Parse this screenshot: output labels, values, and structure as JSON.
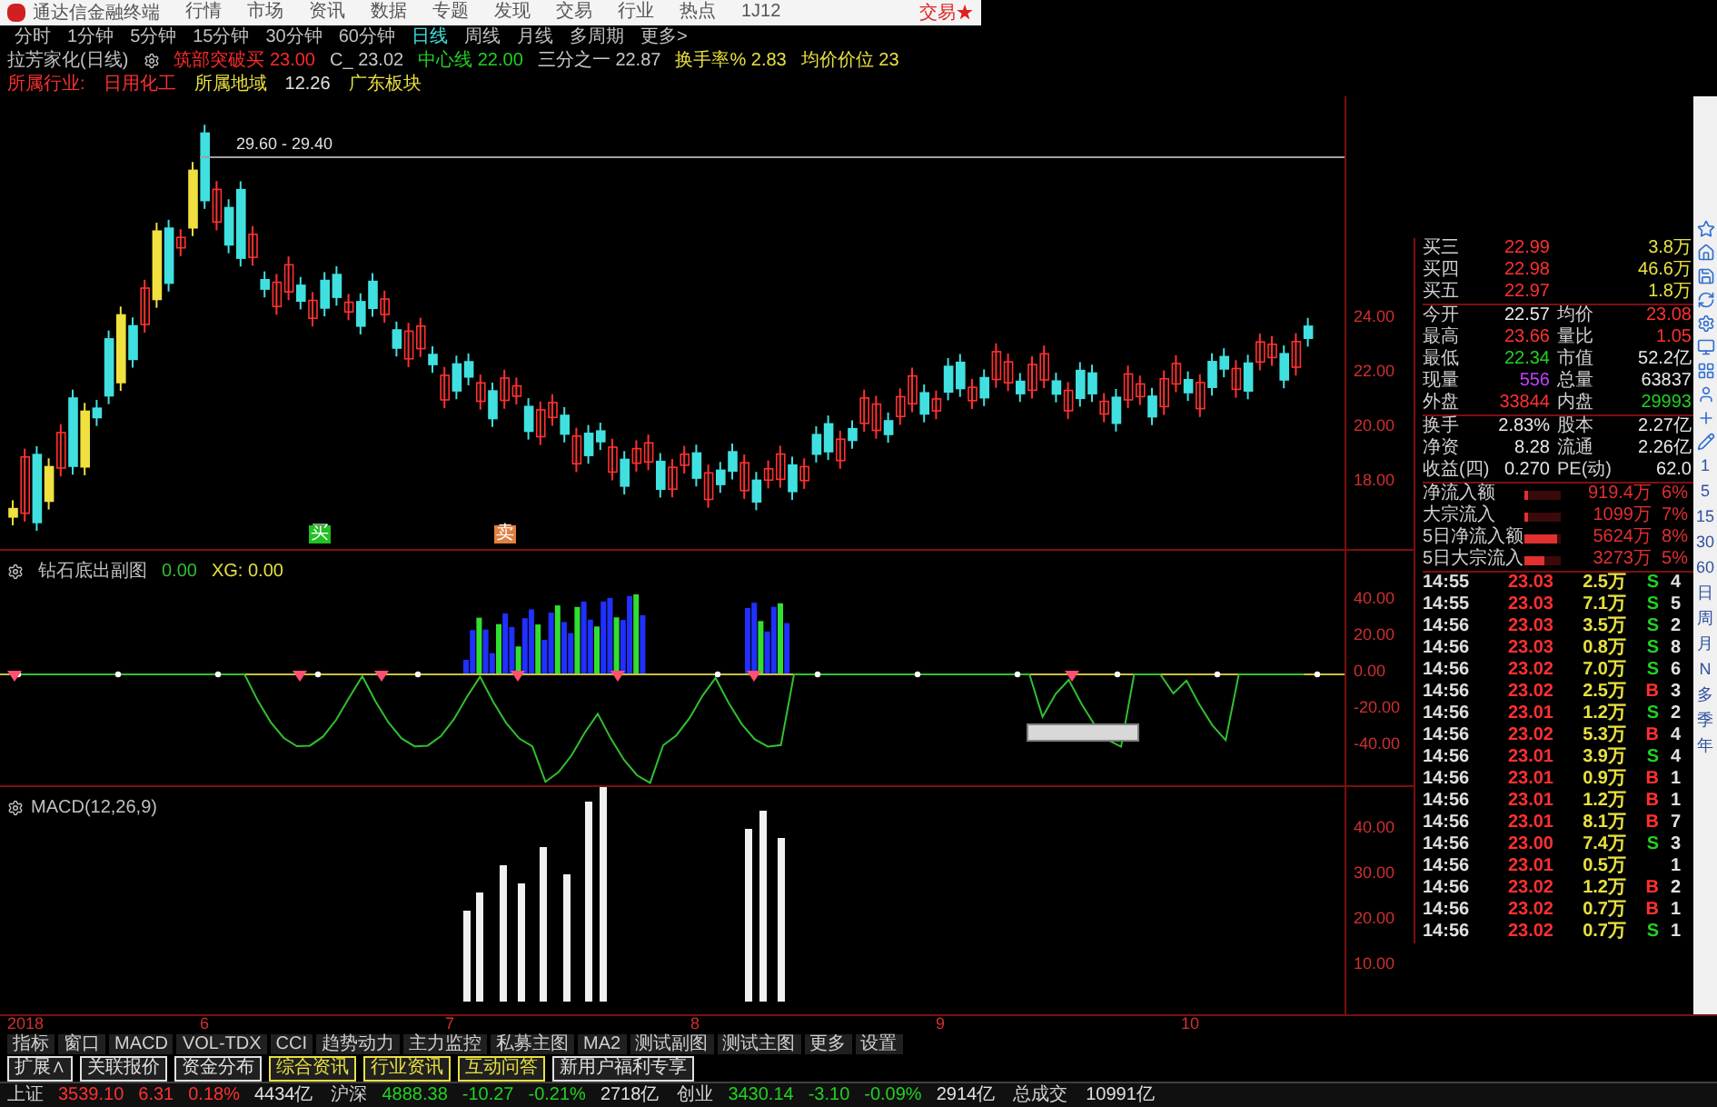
{
  "window": {
    "title": "通达信金融终端",
    "menu": [
      "行情",
      "市场",
      "资讯",
      "数据",
      "专题",
      "发现",
      "交易",
      "行业",
      "热点",
      "1J12"
    ],
    "trade_link": "交易★"
  },
  "periods": [
    {
      "label": "分时",
      "selected": false
    },
    {
      "label": "1分钟",
      "selected": false
    },
    {
      "label": "5分钟",
      "selected": false
    },
    {
      "label": "15分钟",
      "selected": false
    },
    {
      "label": "30分钟",
      "selected": false
    },
    {
      "label": "60分钟",
      "selected": false
    },
    {
      "label": "日线",
      "selected": true
    },
    {
      "label": "周线",
      "selected": false
    },
    {
      "label": "月线",
      "selected": false
    },
    {
      "label": "多周期",
      "selected": false
    },
    {
      "label": "更多>",
      "selected": false
    }
  ],
  "info": {
    "stock": "拉芳家化(日线)",
    "items": [
      {
        "label": "筑部突破买",
        "value": "23.00",
        "color": "#ff2a2a"
      },
      {
        "label": "C_",
        "value": "23.02",
        "color": "#c8c8c8"
      },
      {
        "label": "中心线",
        "value": "22.00",
        "color": "#22d022"
      },
      {
        "label": "三分之一",
        "value": "22.87",
        "color": "#c8c8c8"
      },
      {
        "label": "换手率%",
        "value": "2.83",
        "color": "#e8e040"
      },
      {
        "label": "均价价位",
        "value": "23",
        "color": "#e8e040"
      }
    ]
  },
  "tags": [
    {
      "text": "所属行业:",
      "color": "#ff3030"
    },
    {
      "text": "日用化工",
      "color": "#ff3030"
    },
    {
      "text": "所属地域",
      "color": "#e8e040"
    },
    {
      "text": "12.26",
      "color": "#e0e0e0"
    },
    {
      "text": "广东板块",
      "color": "#e8e040"
    }
  ],
  "main_chart": {
    "range_label": "29.60 - 29.40",
    "axis": [
      "24.00",
      "22.00",
      "20.00",
      "18.00"
    ],
    "signals": [
      {
        "text": "买",
        "color": "#22c022"
      },
      {
        "text": "卖",
        "color": "#e08040"
      }
    ]
  },
  "sub_chart": {
    "title": "钻石底出副图",
    "value": "0.00",
    "xg_label": "XG: 0.00",
    "axis": [
      "40.00",
      "20.00",
      "0.00",
      "-20.00",
      "-40.00"
    ]
  },
  "macd_chart": {
    "title": "MACD(12,26,9)",
    "axis": [
      "40.00",
      "30.00",
      "20.00",
      "10.00"
    ]
  },
  "dates": [
    "2018",
    "6",
    "7",
    "8",
    "9",
    "10"
  ],
  "quotes": [
    {
      "left": {
        "label": "买三",
        "value": "22.99",
        "color": "#ff3030"
      },
      "right": {
        "value": "3.8万",
        "color": "#e8e040"
      }
    },
    {
      "left": {
        "label": "买四",
        "value": "22.98",
        "color": "#ff3030"
      },
      "right": {
        "value": "46.6万",
        "color": "#e8e040"
      }
    },
    {
      "left": {
        "label": "买五",
        "value": "22.97",
        "color": "#ff3030"
      },
      "right": {
        "value": "1.8万",
        "color": "#e8e040"
      }
    },
    {
      "left": {
        "label": "今开",
        "value": "22.57",
        "color": "#e8e8e8"
      },
      "right": {
        "label": "均价",
        "value": "23.08",
        "color": "#ff3030"
      }
    },
    {
      "left": {
        "label": "最高",
        "value": "23.66",
        "color": "#ff3030"
      },
      "right": {
        "label": "量比",
        "value": "1.05",
        "color": "#ff3030"
      }
    },
    {
      "left": {
        "label": "最低",
        "value": "22.34",
        "color": "#22d022"
      },
      "right": {
        "label": "市值",
        "value": "52.2亿",
        "color": "#e8e8e8"
      }
    },
    {
      "left": {
        "label": "现量",
        "value": "556",
        "color": "#c040ff"
      },
      "right": {
        "label": "总量",
        "value": "63837",
        "color": "#e8e8e8"
      }
    },
    {
      "left": {
        "label": "外盘",
        "value": "33844",
        "color": "#ff3030"
      },
      "right": {
        "label": "内盘",
        "value": "29993",
        "color": "#22d022"
      }
    },
    {
      "left": {
        "label": "换手",
        "value": "2.83%",
        "color": "#e8e8e8"
      },
      "right": {
        "label": "股本",
        "value": "2.27亿",
        "color": "#e8e8e8"
      }
    },
    {
      "left": {
        "label": "净资",
        "value": "8.28",
        "color": "#e8e8e8"
      },
      "right": {
        "label": "流通",
        "value": "2.26亿",
        "color": "#e8e8e8"
      }
    },
    {
      "left": {
        "label": "收益(四)",
        "value": "0.270",
        "color": "#e8e8e8"
      },
      "right": {
        "label": "PE(动)",
        "value": "62.0",
        "color": "#e8e8e8"
      }
    }
  ],
  "flows": [
    {
      "label": "净流入额",
      "level": 0.1,
      "amount": "919.4万",
      "pct": "6%"
    },
    {
      "label": "大宗流入",
      "level": 0.1,
      "amount": "1099万",
      "pct": "7%"
    },
    {
      "label": "5日净流入额",
      "level": 0.9,
      "amount": "5624万",
      "pct": "8%"
    },
    {
      "label": "5日大宗流入",
      "level": 0.55,
      "amount": "3273万",
      "pct": "5%"
    }
  ],
  "trades": [
    {
      "time": "14:55",
      "price": "23.03",
      "volume": "2.5万",
      "side": "S",
      "count": "4"
    },
    {
      "time": "14:55",
      "price": "23.03",
      "volume": "7.1万",
      "side": "S",
      "count": "5"
    },
    {
      "time": "14:56",
      "price": "23.03",
      "volume": "3.5万",
      "side": "S",
      "count": "2"
    },
    {
      "time": "14:56",
      "price": "23.03",
      "volume": "0.8万",
      "side": "S",
      "count": "8"
    },
    {
      "time": "14:56",
      "price": "23.02",
      "volume": "7.0万",
      "side": "S",
      "count": "6"
    },
    {
      "time": "14:56",
      "price": "23.02",
      "volume": "2.5万",
      "side": "B",
      "count": "3"
    },
    {
      "time": "14:56",
      "price": "23.01",
      "volume": "1.2万",
      "side": "S",
      "count": "2"
    },
    {
      "time": "14:56",
      "price": "23.02",
      "volume": "5.3万",
      "side": "B",
      "count": "4"
    },
    {
      "time": "14:56",
      "price": "23.01",
      "volume": "3.9万",
      "side": "S",
      "count": "4"
    },
    {
      "time": "14:56",
      "price": "23.01",
      "volume": "0.9万",
      "side": "B",
      "count": "1"
    },
    {
      "time": "14:56",
      "price": "23.01",
      "volume": "1.2万",
      "side": "B",
      "count": "1"
    },
    {
      "time": "14:56",
      "price": "23.01",
      "volume": "8.1万",
      "side": "B",
      "count": "7"
    },
    {
      "time": "14:56",
      "price": "23.00",
      "volume": "7.4万",
      "side": "S",
      "count": "3"
    },
    {
      "time": "14:56",
      "price": "23.01",
      "volume": "0.5万",
      "count": "1"
    },
    {
      "time": "14:56",
      "price": "23.02",
      "volume": "1.2万",
      "side": "B",
      "count": "2"
    },
    {
      "time": "14:56",
      "price": "23.02",
      "volume": "0.7万",
      "side": "B",
      "count": "1"
    },
    {
      "time": "14:56",
      "price": "23.02",
      "volume": "0.7万",
      "side": "S",
      "count": "1"
    }
  ],
  "toolbar": [
    "1",
    "5",
    "15",
    "30",
    "60",
    "日",
    "周",
    "月",
    "N",
    "多",
    "季",
    "年"
  ],
  "bottom_tabs": [
    "指标",
    "窗口",
    "MACD",
    "VOL-TDX",
    "CCI",
    "趋势动力",
    "主力监控",
    "私募主图",
    "MA2",
    "测试副图",
    "测试主图",
    "更多",
    "设置"
  ],
  "ext_links": [
    {
      "text": "扩展∧",
      "color": "#e0e0e0"
    },
    {
      "text": "关联报价",
      "color": "#e0e0e0"
    },
    {
      "text": "资金分布",
      "color": "#e0e0e0"
    },
    {
      "text": "综合资讯",
      "color": "#e8e040"
    },
    {
      "text": "行业资讯",
      "color": "#e8e040"
    },
    {
      "text": "互动问答",
      "color": "#e8e040"
    },
    {
      "text": "新用户福利专享",
      "color": "#e0e0e0"
    }
  ],
  "indices": [
    {
      "name": "上证",
      "value": "3539.10",
      "change": "6.31",
      "pct": "0.18%",
      "amount": "4434亿",
      "color": "#ff3030"
    },
    {
      "name": "沪深",
      "value": "4888.38",
      "change": "-10.27",
      "pct": "-0.21%",
      "amount": "2718亿",
      "color": "#22d022"
    },
    {
      "name": "创业",
      "value": "3430.14",
      "change": "-3.10",
      "pct": "-0.09%",
      "amount": "2914亿",
      "color": "#22d022"
    }
  ],
  "total": {
    "label": "总成交",
    "value": "10991亿"
  }
}
